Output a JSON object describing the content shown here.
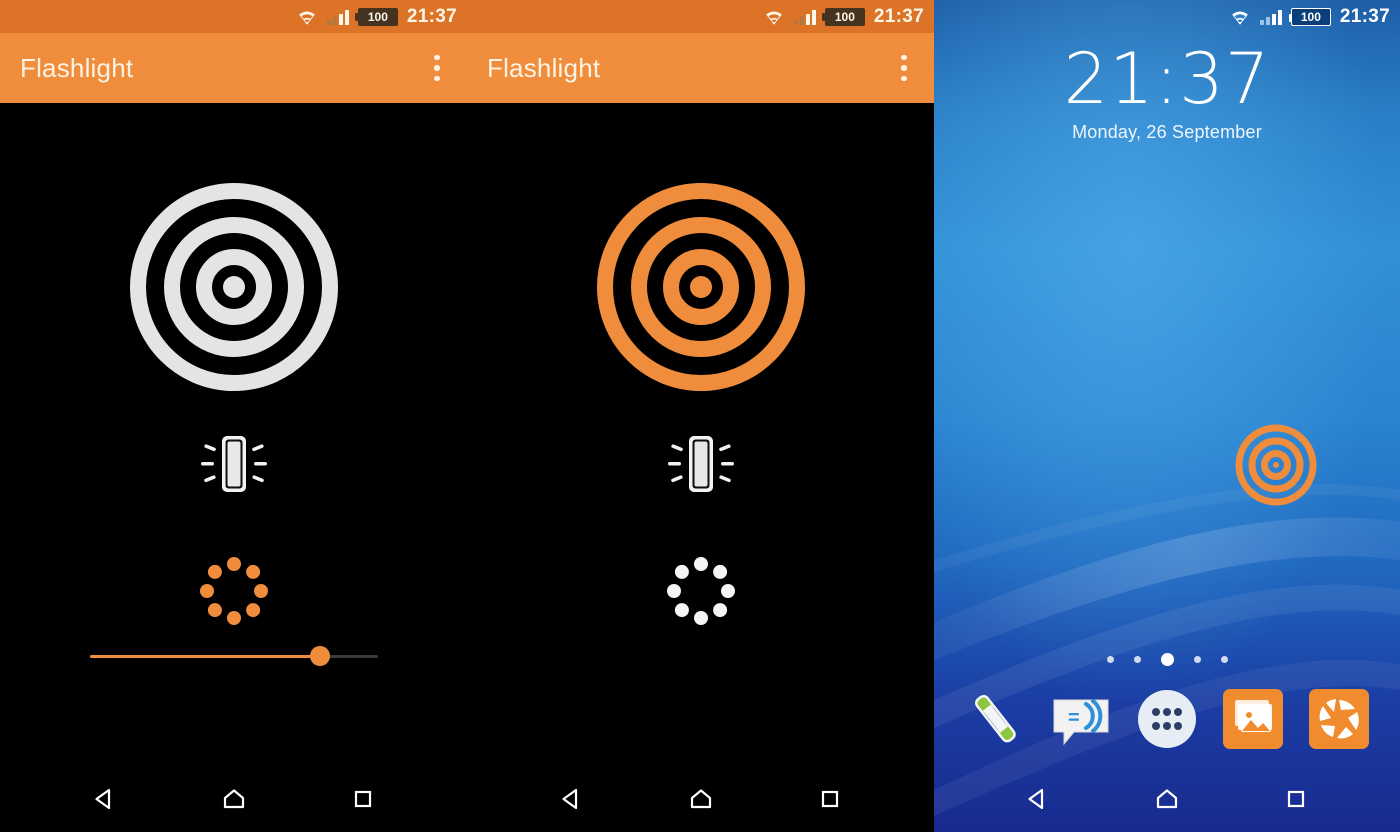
{
  "colors": {
    "status_bar_orange": "#dd7326",
    "app_bar_orange": "#ef8d3c",
    "accent_orange": "#ef8d3c",
    "icon_white": "#e8e8e8",
    "screen_black": "#000000",
    "wallpaper_blue_top": "#2f8fd8",
    "wallpaper_blue_bottom": "#1b2d8f",
    "slider_track": "#3a3a3a"
  },
  "panels": [
    {
      "id": "flashlight-off",
      "statusbar": {
        "time": "21:37",
        "battery_level": "100",
        "wifi_icon": "wifi-icon",
        "signal_icon": "signal-bars-icon",
        "battery_icon": "battery-icon"
      },
      "appbar": {
        "title": "Flashlight",
        "overflow_icon": "overflow-menu-icon"
      },
      "controls": {
        "power_icon": "bullseye-power-icon",
        "power_state": "off",
        "power_color": "#e8e8e8",
        "vibrate_icon": "vibrate-icon",
        "vibrate_color": "#f2f2f2",
        "strobe_icon": "strobe-dots-icon",
        "strobe_color": "#ef8d3c",
        "slider": {
          "name": "strobe-speed-slider",
          "value_percent": 80
        }
      },
      "navbar": {
        "back": "back-icon",
        "home": "home-icon",
        "recents": "recents-icon"
      }
    },
    {
      "id": "flashlight-on",
      "statusbar": {
        "time": "21:37",
        "battery_level": "100",
        "wifi_icon": "wifi-icon",
        "signal_icon": "signal-bars-icon",
        "battery_icon": "battery-icon"
      },
      "appbar": {
        "title": "Flashlight",
        "overflow_icon": "overflow-menu-icon"
      },
      "controls": {
        "power_icon": "bullseye-power-icon",
        "power_state": "on",
        "power_color": "#ef8d3c",
        "vibrate_icon": "vibrate-icon",
        "vibrate_color": "#f2f2f2",
        "strobe_icon": "strobe-dots-icon",
        "strobe_color": "#f5f5f5",
        "slider": null
      },
      "navbar": {
        "back": "back-icon",
        "home": "home-icon",
        "recents": "recents-icon"
      }
    }
  ],
  "homescreen": {
    "statusbar": {
      "time": "21:37",
      "battery_level": "100",
      "wifi_icon": "wifi-icon",
      "signal_icon": "signal-bars-icon",
      "battery_icon": "battery-icon"
    },
    "clock": {
      "time": "21:37",
      "date": "Monday, 26 September"
    },
    "widget": {
      "name": "flashlight-widget",
      "icon": "bullseye-widget-icon",
      "color": "#ef8d3c"
    },
    "page_indicator": {
      "count": 5,
      "active_index": 2
    },
    "dock": [
      {
        "name": "dock-phone",
        "icon": "phone-icon",
        "label": "Phone"
      },
      {
        "name": "dock-messaging",
        "icon": "messaging-icon",
        "label": "Messaging"
      },
      {
        "name": "dock-app-drawer",
        "icon": "app-drawer-icon",
        "label": "Apps"
      },
      {
        "name": "dock-gallery",
        "icon": "gallery-icon",
        "label": "Album"
      },
      {
        "name": "dock-camera",
        "icon": "camera-icon",
        "label": "Camera"
      }
    ],
    "navbar": {
      "back": "back-icon",
      "home": "home-icon",
      "recents": "recents-icon"
    }
  }
}
